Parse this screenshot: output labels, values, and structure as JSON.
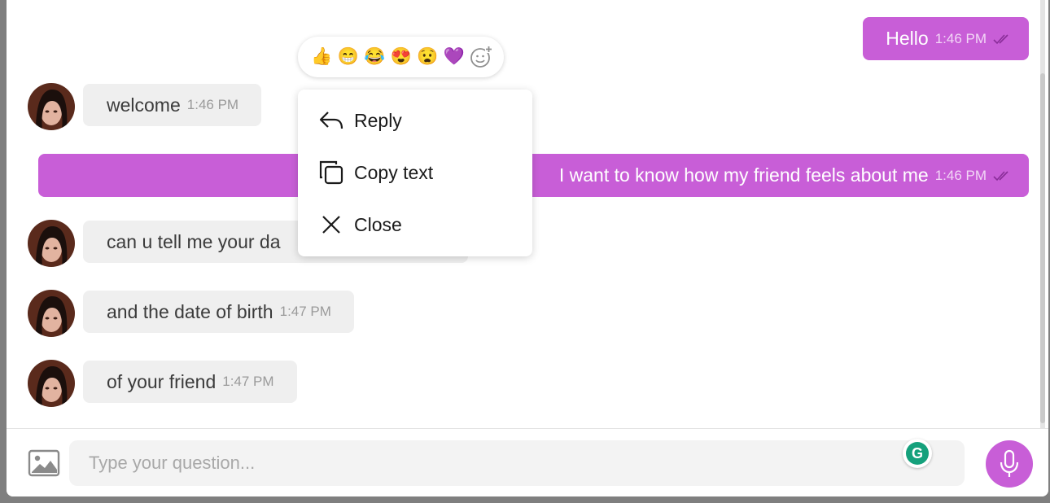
{
  "colors": {
    "accent": "#c85ed7",
    "incoming_bubble": "#efefef",
    "grammarly": "#15a17c"
  },
  "messages": [
    {
      "direction": "outgoing",
      "text": "Hello",
      "time": "1:46 PM",
      "status": "read"
    },
    {
      "direction": "incoming",
      "text": "welcome",
      "time": "1:46 PM"
    },
    {
      "direction": "outgoing",
      "text": "I want to know how my friend feels about me",
      "time": "1:46 PM",
      "status": "read"
    },
    {
      "direction": "incoming",
      "text": "can u tell me your da",
      "time": ""
    },
    {
      "direction": "incoming",
      "text": "and the date of birth",
      "time": "1:47 PM"
    },
    {
      "direction": "incoming",
      "text": "of your friend",
      "time": "1:47 PM"
    }
  ],
  "reactions": [
    "👍",
    "😁",
    "😂",
    "😍",
    "😧",
    "💜"
  ],
  "reaction_add_icon": "add-emoji-icon",
  "context_menu": {
    "items": [
      {
        "label": "Reply",
        "icon": "reply-icon"
      },
      {
        "label": "Copy text",
        "icon": "copy-icon"
      },
      {
        "label": "Close",
        "icon": "close-icon"
      }
    ]
  },
  "composer": {
    "placeholder": "Type your question...",
    "attach_icon": "image-icon",
    "send_icon": "microphone-icon",
    "grammarly_letter": "G"
  }
}
